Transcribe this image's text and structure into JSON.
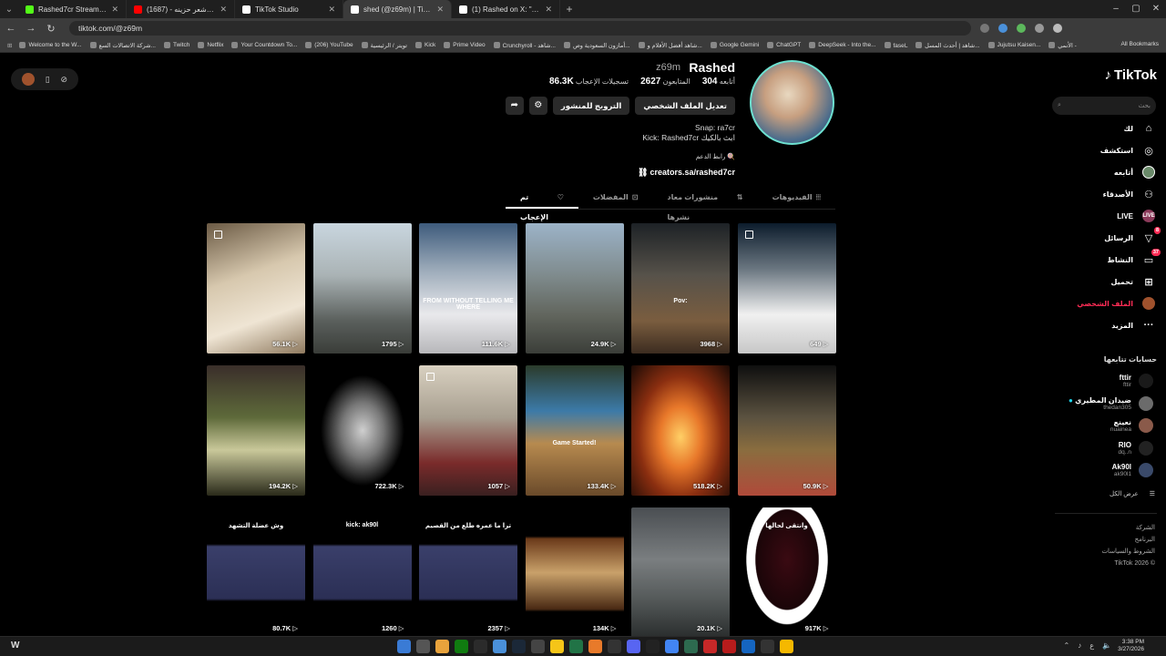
{
  "browser": {
    "tabs": [
      {
        "title": "Rashed7cr Stream - Watch Live",
        "color": "#53fc18"
      },
      {
        "title": "موسيقى شعر حزينه - (1687) be",
        "color": "#ff0000"
      },
      {
        "title": "TikTok Studio",
        "color": "#ffffff"
      },
      {
        "title": "shed (@z69m) | TikTok (43)",
        "color": "#ffffff",
        "active": true
      },
      {
        "title": "(1) Rashed on X: \"التي الطبيعي",
        "color": "#ffffff"
      }
    ],
    "url": "tiktok.com/@z69m",
    "bookmarks": [
      "Welcome to the W...",
      "شركة الاتصالات السع...",
      "Twitch",
      "Netflix",
      "Your Countdown To...",
      "(206) YouTube",
      "تويتر / الرئيسية",
      "Kick",
      "Prime Video",
      "Crunchyroll - شاهد...",
      "أمازون السعودية وص...",
      "شاهد أفضل الأفلام و...",
      "Google Gemini",
      "ChatGPT",
      "DeepSeek - Into the...",
      "faselـ",
      "شاهد | أحدث المسل...",
      "Jujutsu Kaisen...",
      "الأنمي -"
    ],
    "all_bookmarks": "All Bookmarks"
  },
  "sidebar": {
    "logo": "TikTok",
    "search_placeholder": "بحث",
    "nav": [
      {
        "label": "لك",
        "icon": "home-icon",
        "glyph": "⌂"
      },
      {
        "label": "استكشف",
        "icon": "compass-icon",
        "glyph": "◎"
      },
      {
        "label": "أتابعه",
        "icon": "following-avatar-icon",
        "glyph": ""
      },
      {
        "label": "الأصدقاء",
        "icon": "friends-icon",
        "glyph": "⚇"
      },
      {
        "label": "LIVE",
        "icon": "live-icon",
        "glyph": "LIVE"
      },
      {
        "label": "الرسائل",
        "icon": "messages-icon",
        "glyph": "▽",
        "badge": "8"
      },
      {
        "label": "النشاط",
        "icon": "activity-icon",
        "glyph": "▭",
        "badge": "37"
      },
      {
        "label": "تحميل",
        "icon": "upload-icon",
        "glyph": "⊞"
      },
      {
        "label": "الملف الشخصي",
        "icon": "profile-avatar-icon",
        "glyph": "",
        "active": true
      },
      {
        "label": "المزيد",
        "icon": "more-icon",
        "glyph": "···"
      }
    ],
    "following_title": "حسابات تتابعها",
    "following": [
      {
        "name": "fttir",
        "handle": "fttir"
      },
      {
        "name": "ضيدان المطيري",
        "handle": "thedan305",
        "verified": true
      },
      {
        "name": "نعينع",
        "handle": "nuainea"
      },
      {
        "name": "RIO",
        "handle": "dq..n"
      },
      {
        "name": "Ak90l",
        "handle": "ak90l1"
      }
    ],
    "see_all": "عرض الكل",
    "footer": [
      "الشركة",
      "البرنامج",
      "الشروط والسياسات",
      "TikTok 2026 ©"
    ]
  },
  "profile": {
    "username": "Rashed",
    "handle": "z69m",
    "stats": [
      {
        "label": "أتابعه",
        "value": "304"
      },
      {
        "label": "المتابعون",
        "value": "2627"
      },
      {
        "label": "تسجيلات الإعجاب",
        "value": "86.3K"
      }
    ],
    "buttons": {
      "edit": "تعديل الملف الشخصي",
      "promote": "الترويج للمنشور"
    },
    "bio": [
      "Snap: ra7cr",
      "Kick: Rashed7cr ابث بالكيك"
    ],
    "support": "رابط الدعم 🍭",
    "link": "creators.sa/rashed7cr"
  },
  "tabs": [
    {
      "label": "الفيديوهات",
      "glyph": "⦙⦙⦙"
    },
    {
      "label": "منشورات معاد نشرها",
      "glyph": "⇅"
    },
    {
      "label": "المفضلات",
      "glyph": "⊡"
    },
    {
      "label": "تم الإعجاب",
      "glyph": "♡",
      "active": true
    }
  ],
  "videos": [
    {
      "views": "56.1K",
      "style": "c-beige",
      "pinned": true
    },
    {
      "views": "1795",
      "style": "c-road"
    },
    {
      "views": "111.6K",
      "style": "c-men",
      "caption": "FROM WITHOUT TELLING ME WHERE"
    },
    {
      "views": "24.9K",
      "style": "c-street"
    },
    {
      "views": "3968",
      "style": "c-game2",
      "caption": "Pov:"
    },
    {
      "views": "649",
      "style": "c-car",
      "pinned": true
    },
    {
      "views": "194.2K",
      "style": "c-art"
    },
    {
      "views": "722.3K",
      "style": "c-bw"
    },
    {
      "views": "1057",
      "style": "c-sheikh",
      "pinned": true
    },
    {
      "views": "133.4K",
      "style": "c-mc",
      "caption": "Game Started!"
    },
    {
      "views": "518.2K",
      "style": "c-fire"
    },
    {
      "views": "50.9K",
      "style": "c-pots"
    },
    {
      "views": "80.7K",
      "style": "c-stream",
      "caption": "وش عضلة التشهد"
    },
    {
      "views": "1260",
      "style": "c-stream",
      "caption": "kick: ak90l"
    },
    {
      "views": "2357",
      "style": "c-stream",
      "caption": "ترا ما عمره طلع من القصيم"
    },
    {
      "views": "134K",
      "style": "c-tea"
    },
    {
      "views": "20.1K",
      "style": "c-garage"
    },
    {
      "views": "917K",
      "style": "c-red",
      "caption": "وانتقى لحالها"
    }
  ],
  "taskbar": {
    "time": "3:38 PM",
    "date": "3/27/2026"
  },
  "colors": {
    "accent": "#fe2c55",
    "avatar_ring": "#6de0d0"
  }
}
